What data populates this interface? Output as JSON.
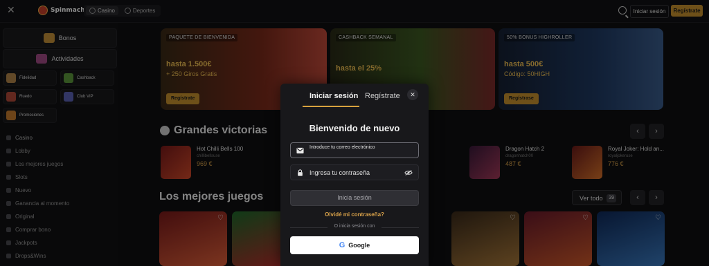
{
  "topbar": {
    "brand": "Spinmacho",
    "tabs": [
      {
        "label": "Casino",
        "active": true
      },
      {
        "label": "Deportes",
        "active": false
      }
    ],
    "login_label": "Iniciar sesión",
    "register_label": "Regístrate"
  },
  "sidebar": {
    "bonos": "Bonos",
    "actividades": "Actividades",
    "grid": [
      "Fidelidad",
      "Cashback",
      "Ruedo",
      "Club VIP",
      "Promociones"
    ],
    "nav": [
      "Casino",
      "Lobby",
      "Los mejores juegos",
      "Slots",
      "Nuevo",
      "Ganancia al momento",
      "Original",
      "Comprar bono",
      "Jackpots",
      "Drops&Wins"
    ]
  },
  "promos": [
    {
      "tag": "PAQUETE DE BIENVENIDA",
      "line1": "hasta 1.500€",
      "line2": "+ 250 Giros Gratis",
      "button": "Regístrate"
    },
    {
      "tag": "CASHBACK SEMANAL",
      "line1": "hasta el 25%",
      "line2": "",
      "button": ""
    },
    {
      "tag": "50% BONUS HIGHROLLER",
      "line1": "hasta 500€",
      "line2": "Código: 50HIGH",
      "button": "Regístrase"
    }
  ],
  "wins": {
    "title": "Grandes victorias",
    "items": [
      {
        "game": "Hot Chilli Bells 100",
        "user": "chillibellsuse",
        "amount": "969 €"
      },
      {
        "game": "Dragon Hatch 2",
        "user": "dragonhatch00",
        "amount": "487 €"
      },
      {
        "game": "Royal Joker: Hold an...",
        "user": "royaljokeruse",
        "amount": "776 €"
      }
    ]
  },
  "best": {
    "title": "Los mejores juegos",
    "see_all": "Ver todo",
    "count": "39"
  },
  "modal": {
    "tab_login": "Iniciar sesión",
    "tab_register": "Regístrate",
    "title": "Bienvenido de nuevo",
    "email_label": "Introduce tu correo electrónico",
    "password_placeholder": "Ingresa tu contraseña",
    "submit": "Inicia sesión",
    "forgot": "Olvidé mi contraseña?",
    "or": "O inicia sesión con",
    "google": "Google"
  }
}
